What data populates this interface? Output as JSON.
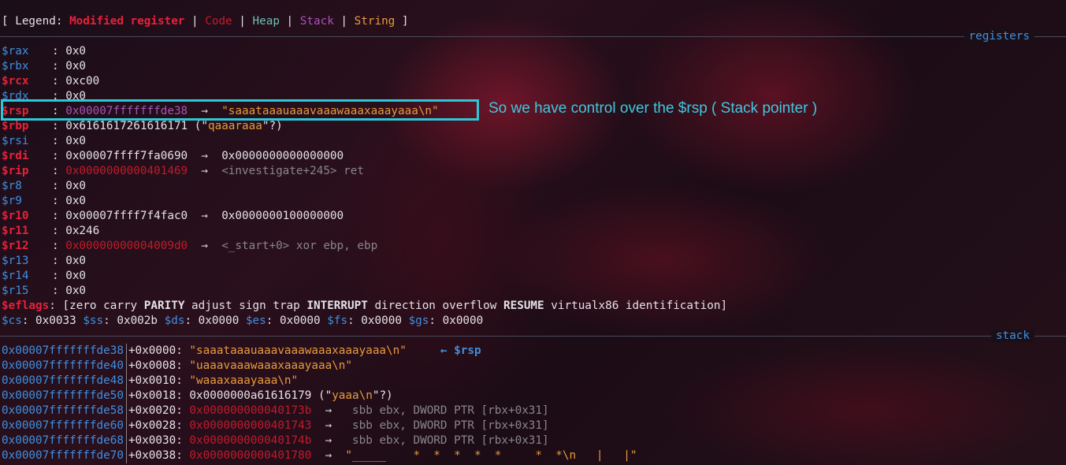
{
  "legend": {
    "open": "[ Legend: ",
    "modified": "Modified register",
    "sep": " | ",
    "code": "Code",
    "heap": "Heap",
    "stack": "Stack",
    "string": "String",
    "close": " ]"
  },
  "sections": {
    "registers": "registers",
    "stack": "stack"
  },
  "annotation": "So we have control over the $rsp ( Stack pointer )",
  "registers": {
    "rax": {
      "name": "$rax",
      "value": "0x0"
    },
    "rbx": {
      "name": "$rbx",
      "value": "0x0"
    },
    "rcx": {
      "name": "$rcx",
      "value": "0xc00"
    },
    "rdx": {
      "name": "$rdx",
      "value": "0x0"
    },
    "rsp": {
      "name": "$rsp",
      "value": "0x00007fffffffde38",
      "arrow": "→",
      "deref": "\"saaataaauaaavaaawaaaxaaayaaa\\n\""
    },
    "rbp": {
      "name": "$rbp",
      "value": "0x6161617261616171",
      "open": " (\"",
      "str": "qaaaraaa",
      "close": "\"?)"
    },
    "rsi": {
      "name": "$rsi",
      "value": "0x0"
    },
    "rdi": {
      "name": "$rdi",
      "value": "0x00007ffff7fa0690",
      "arrow": "→",
      "deref": "0x0000000000000000"
    },
    "rip": {
      "name": "$rip",
      "value": "0x0000000000401469",
      "arrow": "→",
      "deref": "<investigate+245> ret"
    },
    "r8": {
      "name": "$r8",
      "value": "0x0"
    },
    "r9": {
      "name": "$r9",
      "value": "0x0"
    },
    "r10": {
      "name": "$r10",
      "value": "0x00007ffff7f4fac0",
      "arrow": "→",
      "deref": "0x0000000100000000"
    },
    "r11": {
      "name": "$r11",
      "value": "0x246"
    },
    "r12": {
      "name": "$r12",
      "value": "0x00000000004009d0",
      "arrow": "→",
      "deref": "<_start+0> xor ebp, ebp"
    },
    "r13": {
      "name": "$r13",
      "value": "0x0"
    },
    "r14": {
      "name": "$r14",
      "value": "0x0"
    },
    "r15": {
      "name": "$r15",
      "value": "0x0"
    }
  },
  "eflags": {
    "name": "$eflags",
    "open": " [zero carry ",
    "parity": "PARITY",
    "mid1": " adjust sign trap ",
    "interrupt": "INTERRUPT",
    "mid2": " direction overflow ",
    "resume": "RESUME",
    "rest": " virtualx86 identification]"
  },
  "segments": {
    "cs": {
      "name": "$cs",
      "value": "0x0033"
    },
    "ss": {
      "name": "$ss",
      "value": "0x002b"
    },
    "ds": {
      "name": "$ds",
      "value": "0x0000"
    },
    "es": {
      "name": "$es",
      "value": "0x0000"
    },
    "fs": {
      "name": "$fs",
      "value": "0x0000"
    },
    "gs": {
      "name": "$gs",
      "value": "0x0000"
    }
  },
  "stack": [
    {
      "addr": "0x00007fffffffde38",
      "offset": "+0x0000:",
      "value": "\"saaataaauaaavaaawaaaxaaayaaa\\n\"",
      "marker": "← $rsp"
    },
    {
      "addr": "0x00007fffffffde40",
      "offset": "+0x0008:",
      "value": "\"uaaavaaawaaaxaaayaaa\\n\""
    },
    {
      "addr": "0x00007fffffffde48",
      "offset": "+0x0010:",
      "value": "\"waaaxaaayaaa\\n\""
    },
    {
      "addr": "0x00007fffffffde50",
      "offset": "+0x0018:",
      "value": "0x0000000a61616179",
      "open": " (\"",
      "str": "yaaa\\n",
      "close": "\"?)"
    },
    {
      "addr": "0x00007fffffffde58",
      "offset": "+0x0020:",
      "value": "0x000000000040173b",
      "arrow": "→",
      "deref": "sbb ebx, DWORD PTR [rbx+0x31]"
    },
    {
      "addr": "0x00007fffffffde60",
      "offset": "+0x0028:",
      "value": "0x0000000000401743",
      "arrow": "→",
      "deref": "sbb ebx, DWORD PTR [rbx+0x31]"
    },
    {
      "addr": "0x00007fffffffde68",
      "offset": "+0x0030:",
      "value": "0x000000000040174b",
      "arrow": "→",
      "deref": "sbb ebx, DWORD PTR [rbx+0x31]"
    },
    {
      "addr": "0x00007fffffffde70",
      "offset": "+0x0038:",
      "value": "0x0000000000401780",
      "arrow": "→",
      "deref": "\"_____    *  *  *  *  *     *  *\\n   |   |\""
    }
  ]
}
